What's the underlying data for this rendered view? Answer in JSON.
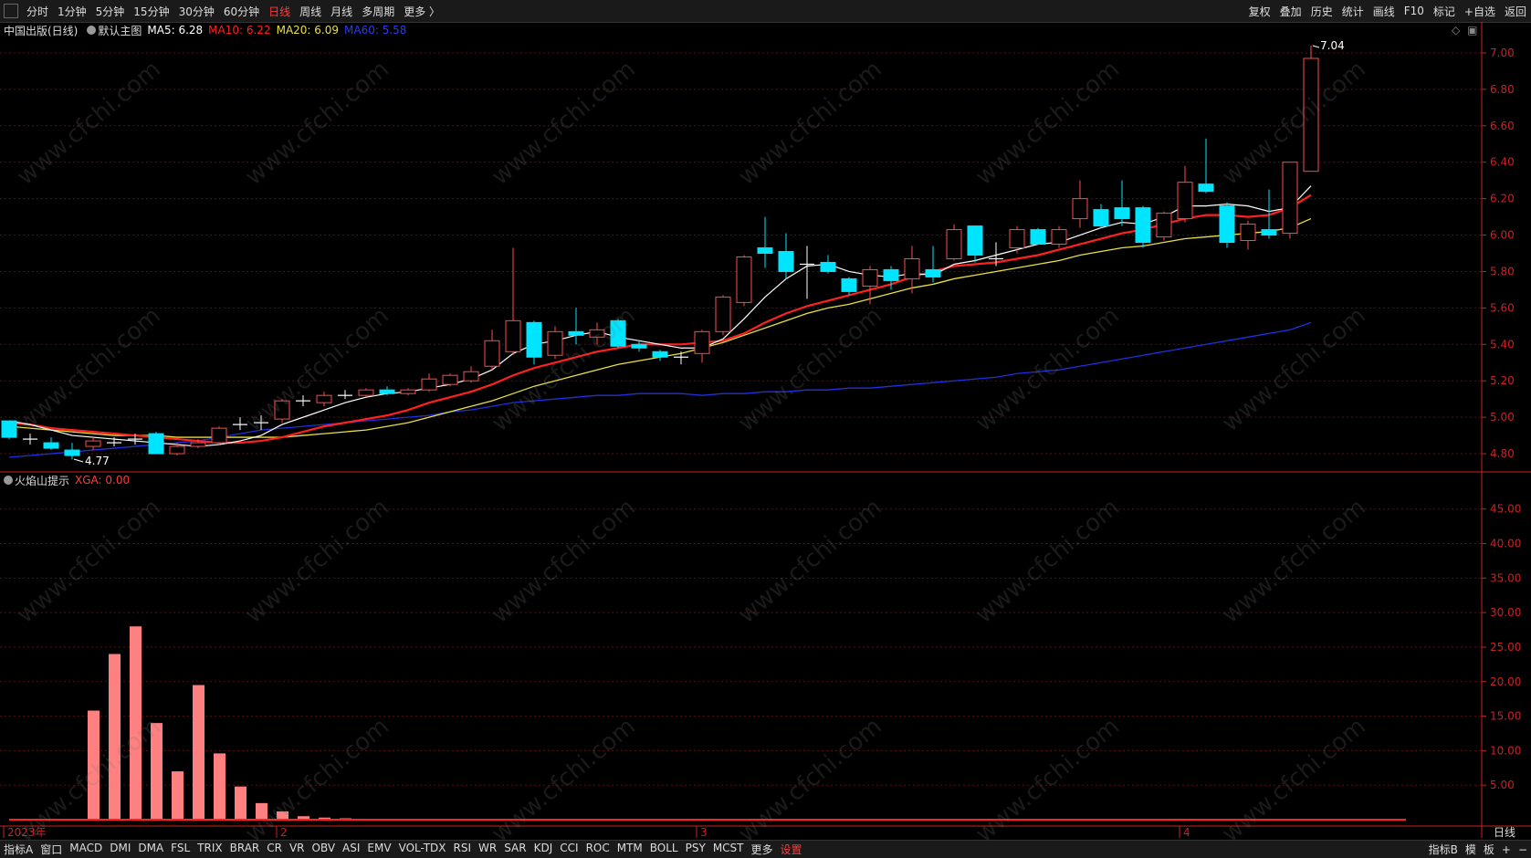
{
  "toolbar": {
    "periods": [
      "分时",
      "1分钟",
      "5分钟",
      "15分钟",
      "30分钟",
      "60分钟",
      "日线",
      "周线",
      "月线",
      "多周期",
      "更多 〉"
    ],
    "active_period": "日线",
    "tools": [
      "复权",
      "叠加",
      "历史",
      "统计",
      "画线",
      "F10",
      "标记",
      "+自选",
      "返回"
    ]
  },
  "main_header": {
    "title": "中国出版(日线)",
    "template": "默认主图",
    "ma5": "MA5: 6.28",
    "ma10": "MA10: 6.22",
    "ma20": "MA20: 6.09",
    "ma60": "MA60: 5.58",
    "right_icons": [
      "◇",
      "▣"
    ]
  },
  "indicator_header": {
    "title": "火焰山提示",
    "xga": "XGA: 0.00"
  },
  "bottom_bar": {
    "tabs": [
      "指标A",
      "窗口",
      "MACD",
      "DMI",
      "DMA",
      "FSL",
      "TRIX",
      "BRAR",
      "CR",
      "VR",
      "OBV",
      "ASI",
      "EMV",
      "VOL-TDX",
      "RSI",
      "WR",
      "SAR",
      "KDJ",
      "CCI",
      "ROC",
      "MTM",
      "BOLL",
      "PSY",
      "MCST",
      "更多",
      "设置"
    ],
    "right": [
      "指标B",
      "模",
      "板",
      "+",
      "−"
    ]
  },
  "colors": {
    "up": "#ff4a4a",
    "down": "#00e5ff",
    "ma5": "#ffffff",
    "ma10": "#ff2020",
    "ma20": "#e8e040",
    "ma60": "#2030e0",
    "flame": "#ff8080",
    "grid": "#5a1010",
    "axis": "#cc2020"
  },
  "watermark": "www.cfchi.com",
  "chart_data": [
    {
      "type": "candlestick",
      "title": "中国出版(日线)",
      "x_labels": [
        "2023年",
        "2",
        "3",
        "4"
      ],
      "x_label_index": [
        0,
        13,
        33,
        56
      ],
      "y_ticks": [
        4.8,
        5.0,
        5.2,
        5.4,
        5.6,
        5.8,
        6.0,
        6.2,
        6.4,
        6.6,
        6.8,
        7.0
      ],
      "ylim": [
        4.7,
        7.08
      ],
      "annotations": [
        {
          "label": "4.77",
          "index": 3,
          "value": 4.77
        },
        {
          "label": "7.04",
          "index": 62,
          "value": 7.04
        }
      ],
      "candles": [
        [
          4.98,
          4.98,
          4.88,
          4.89
        ],
        [
          4.88,
          4.91,
          4.85,
          4.88
        ],
        [
          4.86,
          4.89,
          4.82,
          4.83
        ],
        [
          4.82,
          4.86,
          4.77,
          4.79
        ],
        [
          4.84,
          4.89,
          4.82,
          4.87
        ],
        [
          4.86,
          4.89,
          4.84,
          4.85
        ],
        [
          4.87,
          4.91,
          4.85,
          4.88
        ],
        [
          4.91,
          4.92,
          4.8,
          4.8
        ],
        [
          4.8,
          4.86,
          4.79,
          4.84
        ],
        [
          4.84,
          4.88,
          4.83,
          4.86
        ],
        [
          4.86,
          4.95,
          4.85,
          4.94
        ],
        [
          4.96,
          5.0,
          4.93,
          4.96
        ],
        [
          4.97,
          5.01,
          4.93,
          4.96
        ],
        [
          4.99,
          5.1,
          4.97,
          5.09
        ],
        [
          5.09,
          5.12,
          5.06,
          5.08
        ],
        [
          5.08,
          5.14,
          5.06,
          5.12
        ],
        [
          5.12,
          5.15,
          5.1,
          5.12
        ],
        [
          5.12,
          5.16,
          5.11,
          5.15
        ],
        [
          5.15,
          5.17,
          5.12,
          5.13
        ],
        [
          5.13,
          5.16,
          5.12,
          5.15
        ],
        [
          5.15,
          5.24,
          5.14,
          5.21
        ],
        [
          5.18,
          5.24,
          5.17,
          5.23
        ],
        [
          5.2,
          5.28,
          5.19,
          5.25
        ],
        [
          5.28,
          5.48,
          5.26,
          5.42
        ],
        [
          5.36,
          5.93,
          5.34,
          5.53
        ],
        [
          5.52,
          5.53,
          5.29,
          5.33
        ],
        [
          5.34,
          5.5,
          5.32,
          5.47
        ],
        [
          5.47,
          5.6,
          5.4,
          5.45
        ],
        [
          5.44,
          5.52,
          5.4,
          5.48
        ],
        [
          5.53,
          5.54,
          5.38,
          5.39
        ],
        [
          5.4,
          5.42,
          5.36,
          5.38
        ],
        [
          5.36,
          5.37,
          5.31,
          5.33
        ],
        [
          5.33,
          5.36,
          5.29,
          5.33
        ],
        [
          5.35,
          5.48,
          5.3,
          5.47
        ],
        [
          5.47,
          5.67,
          5.45,
          5.66
        ],
        [
          5.63,
          5.89,
          5.61,
          5.88
        ],
        [
          5.93,
          6.1,
          5.82,
          5.9
        ],
        [
          5.91,
          6.01,
          5.76,
          5.8
        ],
        [
          5.84,
          5.94,
          5.65,
          5.84
        ],
        [
          5.85,
          5.89,
          5.79,
          5.8
        ],
        [
          5.76,
          5.77,
          5.67,
          5.69
        ],
        [
          5.72,
          5.83,
          5.62,
          5.81
        ],
        [
          5.81,
          5.83,
          5.7,
          5.75
        ],
        [
          5.76,
          5.94,
          5.68,
          5.87
        ],
        [
          5.81,
          5.94,
          5.74,
          5.77
        ],
        [
          5.87,
          6.06,
          5.86,
          6.03
        ],
        [
          6.05,
          6.05,
          5.85,
          5.89
        ],
        [
          5.87,
          5.96,
          5.83,
          5.87
        ],
        [
          5.93,
          6.05,
          5.9,
          6.03
        ],
        [
          6.03,
          6.04,
          5.95,
          5.95
        ],
        [
          5.95,
          6.05,
          5.93,
          6.03
        ],
        [
          6.09,
          6.3,
          6.04,
          6.2
        ],
        [
          6.14,
          6.17,
          6.04,
          6.05
        ],
        [
          6.15,
          6.3,
          6.05,
          6.09
        ],
        [
          6.15,
          6.16,
          5.93,
          5.96
        ],
        [
          5.99,
          6.13,
          5.97,
          6.12
        ],
        [
          6.09,
          6.38,
          6.07,
          6.29
        ],
        [
          6.28,
          6.53,
          6.23,
          6.24
        ],
        [
          6.16,
          6.18,
          5.93,
          5.96
        ],
        [
          5.97,
          6.08,
          5.92,
          6.06
        ],
        [
          6.03,
          6.25,
          5.98,
          6.0
        ],
        [
          6.01,
          6.4,
          5.98,
          6.4
        ],
        [
          6.35,
          7.04,
          6.35,
          6.97
        ]
      ],
      "ma5": [
        4.98,
        4.96,
        4.93,
        4.9,
        4.89,
        4.88,
        4.87,
        4.86,
        4.85,
        4.84,
        4.85,
        4.87,
        4.9,
        4.96,
        5.0,
        5.04,
        5.08,
        5.11,
        5.13,
        5.14,
        5.16,
        5.18,
        5.21,
        5.26,
        5.35,
        5.4,
        5.42,
        5.45,
        5.47,
        5.44,
        5.42,
        5.4,
        5.38,
        5.38,
        5.43,
        5.54,
        5.66,
        5.76,
        5.83,
        5.84,
        5.8,
        5.78,
        5.77,
        5.79,
        5.78,
        5.84,
        5.86,
        5.89,
        5.92,
        5.95,
        5.96,
        6.0,
        6.04,
        6.07,
        6.06,
        6.1,
        6.16,
        6.16,
        6.17,
        6.16,
        6.13,
        6.15,
        6.27
      ],
      "ma10": [
        4.97,
        4.96,
        4.94,
        4.93,
        4.92,
        4.91,
        4.9,
        4.89,
        4.88,
        4.87,
        4.86,
        4.86,
        4.87,
        4.89,
        4.92,
        4.95,
        4.97,
        4.99,
        5.01,
        5.04,
        5.08,
        5.11,
        5.14,
        5.18,
        5.23,
        5.27,
        5.3,
        5.33,
        5.36,
        5.38,
        5.4,
        5.4,
        5.4,
        5.41,
        5.42,
        5.46,
        5.52,
        5.57,
        5.61,
        5.64,
        5.67,
        5.7,
        5.73,
        5.77,
        5.8,
        5.83,
        5.84,
        5.85,
        5.87,
        5.89,
        5.92,
        5.95,
        5.98,
        6.01,
        6.03,
        6.06,
        6.09,
        6.11,
        6.11,
        6.1,
        6.11,
        6.15,
        6.22
      ],
      "ma20": [
        4.95,
        4.94,
        4.93,
        4.92,
        4.91,
        4.9,
        4.9,
        4.9,
        4.89,
        4.89,
        4.89,
        4.89,
        4.89,
        4.89,
        4.9,
        4.91,
        4.92,
        4.93,
        4.95,
        4.97,
        5.0,
        5.03,
        5.06,
        5.09,
        5.13,
        5.17,
        5.2,
        5.23,
        5.26,
        5.29,
        5.31,
        5.33,
        5.35,
        5.38,
        5.41,
        5.45,
        5.49,
        5.53,
        5.57,
        5.6,
        5.62,
        5.65,
        5.68,
        5.71,
        5.73,
        5.76,
        5.78,
        5.8,
        5.82,
        5.84,
        5.86,
        5.89,
        5.91,
        5.93,
        5.94,
        5.96,
        5.98,
        5.99,
        6.0,
        6.01,
        6.02,
        6.04,
        6.09
      ],
      "ma60": [
        4.78,
        4.79,
        4.8,
        4.81,
        4.82,
        4.83,
        4.84,
        4.85,
        4.86,
        4.87,
        4.89,
        4.91,
        4.93,
        4.94,
        4.95,
        4.96,
        4.97,
        4.98,
        4.99,
        5.0,
        5.01,
        5.03,
        5.04,
        5.06,
        5.08,
        5.09,
        5.1,
        5.11,
        5.12,
        5.12,
        5.13,
        5.13,
        5.13,
        5.12,
        5.13,
        5.13,
        5.14,
        5.14,
        5.15,
        5.15,
        5.16,
        5.16,
        5.17,
        5.18,
        5.19,
        5.2,
        5.21,
        5.22,
        5.24,
        5.25,
        5.26,
        5.28,
        5.3,
        5.32,
        5.34,
        5.36,
        5.38,
        5.4,
        5.42,
        5.44,
        5.46,
        5.48,
        5.52
      ]
    },
    {
      "type": "bar",
      "title": "火焰山提示",
      "series": [
        {
          "name": "XGA",
          "values": [
            0,
            0,
            15.8,
            24.0,
            28.0,
            14.0,
            7.0,
            19.5,
            9.6,
            4.8,
            2.4,
            1.2,
            0.5,
            0.3,
            0.2,
            0.1,
            0.1,
            0.1,
            0.1,
            0.1,
            0.1,
            0.1,
            0.1,
            0.1,
            0.1,
            0.1,
            0.1,
            0,
            0,
            0,
            0,
            0,
            0,
            0,
            0,
            0,
            0,
            0,
            0,
            0,
            0,
            0,
            0,
            0,
            0,
            0,
            0,
            0,
            0,
            0,
            0,
            0,
            0,
            0,
            0,
            0,
            0,
            0,
            0,
            0,
            0,
            0,
            0
          ]
        }
      ],
      "y_ticks": [
        5.0,
        10.0,
        15.0,
        20.0,
        25.0,
        30.0,
        35.0,
        40.0,
        45.0
      ],
      "ylim": [
        0,
        48
      ]
    }
  ]
}
